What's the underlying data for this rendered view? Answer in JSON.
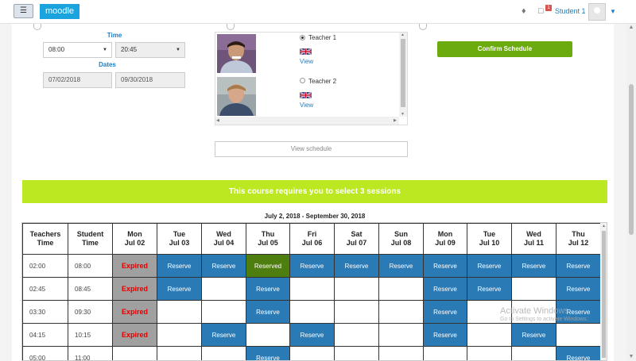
{
  "navbar": {
    "menu_icon": "hamburger-icon",
    "brand": "moodle",
    "notification_badge": "1",
    "user_name": "Student 1"
  },
  "filters": {
    "time_label": "Time",
    "time_from": "08:00",
    "time_to": "20:45",
    "dates_label": "Dates",
    "date_from": "07/02/2018",
    "date_to": "09/30/2018"
  },
  "teachers": [
    {
      "name": "Teacher 1",
      "selected": true,
      "view": "View"
    },
    {
      "name": "Teacher 2",
      "selected": false,
      "view": "View"
    }
  ],
  "buttons": {
    "view_schedule": "View schedule",
    "confirm_schedule": "Confirm Schedule"
  },
  "notice": "This course requires you to select 3 sessions",
  "schedule": {
    "range": "July 2, 2018 - September 30, 2018",
    "col_teachers": [
      "Teachers",
      "Time"
    ],
    "col_student": [
      "Student",
      "Time"
    ],
    "days": [
      [
        "Mon",
        "Jul 02"
      ],
      [
        "Tue",
        "Jul 03"
      ],
      [
        "Wed",
        "Jul 04"
      ],
      [
        "Thu",
        "Jul 05"
      ],
      [
        "Fri",
        "Jul 06"
      ],
      [
        "Sat",
        "Jul 07"
      ],
      [
        "Sun",
        "Jul 08"
      ],
      [
        "Mon",
        "Jul 09"
      ],
      [
        "Tue",
        "Jul 10"
      ],
      [
        "Wed",
        "Jul 11"
      ],
      [
        "Thu",
        "Jul 12"
      ]
    ],
    "rows": [
      {
        "teacher": "02:00",
        "student": "08:00",
        "cells": [
          "expired",
          "reserve",
          "reserve",
          "reserved",
          "reserve",
          "reserve",
          "reserve",
          "reserve",
          "reserve",
          "reserve",
          "reserve"
        ]
      },
      {
        "teacher": "02:45",
        "student": "08:45",
        "cells": [
          "expired",
          "reserve",
          "",
          "reserve",
          "",
          "",
          "",
          "reserve",
          "reserve",
          "",
          "reserve"
        ]
      },
      {
        "teacher": "03:30",
        "student": "09:30",
        "cells": [
          "expired",
          "",
          "",
          "reserve",
          "",
          "",
          "",
          "reserve",
          "",
          "",
          "reserve"
        ]
      },
      {
        "teacher": "04:15",
        "student": "10:15",
        "cells": [
          "expired",
          "",
          "reserve",
          "",
          "reserve",
          "",
          "",
          "reserve",
          "",
          "reserve",
          ""
        ]
      },
      {
        "teacher": "05:00",
        "student": "11:00",
        "cells": [
          "",
          "",
          "",
          "reserve",
          "",
          "",
          "",
          "",
          "",
          "",
          "reserve"
        ]
      }
    ],
    "labels": {
      "expired": "Expired",
      "reserve": "Reserve",
      "reserved": "Reserved"
    }
  },
  "colors": {
    "accent": "#1ba3dd",
    "reserve": "#2a7ab6",
    "reserved": "#4f7e10",
    "expired_text": "#e00000",
    "notice_bg": "#bbe820",
    "confirm_bg": "#6cab0d"
  },
  "watermark": {
    "line1": "Activate Windows",
    "line2": "Go to Settings to activate Windows."
  }
}
